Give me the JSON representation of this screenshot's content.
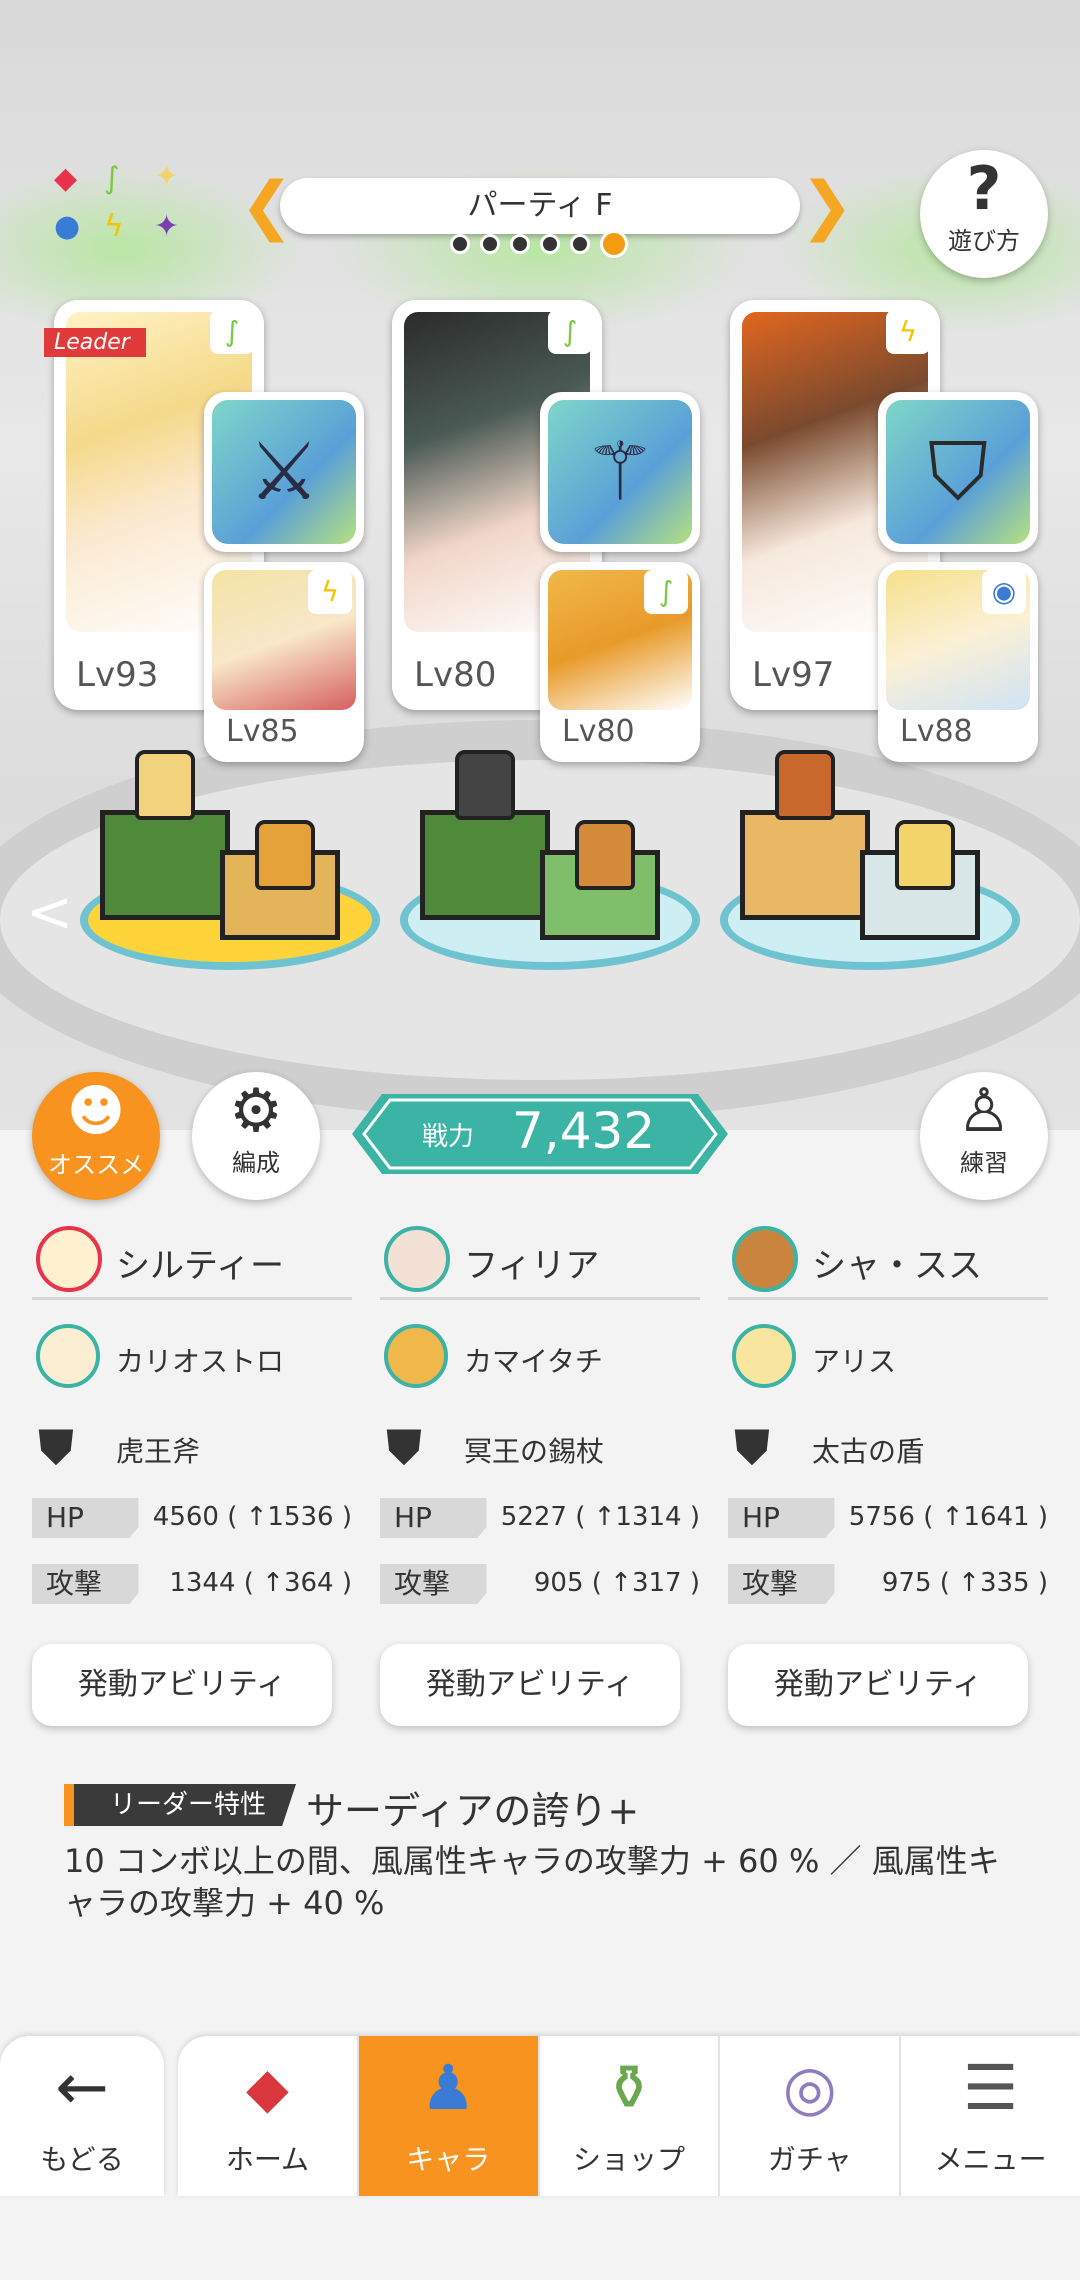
{
  "party": {
    "name": "パーティ F",
    "page_count": 6,
    "active_page": 6
  },
  "help_button": {
    "glyph": "?",
    "label": "遊び方"
  },
  "element_legend": [
    "◆",
    "∫",
    "✦",
    "●",
    "ϟ",
    "✦"
  ],
  "characters": [
    {
      "leader_tag": "Leader",
      "level": "Lv93",
      "element": "wind",
      "sub_level": "Lv85",
      "sub_element": "thunder",
      "name": "シルティー",
      "sub_name": "カリオストロ",
      "weapon": "虎王斧",
      "hp_label": "HP",
      "hp": "4560 ( ↑1536 )",
      "atk_label": "攻撃",
      "atk": "1344 ( ↑364 )",
      "ability_button": "発動アビリティ"
    },
    {
      "leader_tag": "",
      "level": "Lv80",
      "element": "wind",
      "sub_level": "Lv80",
      "sub_element": "wind",
      "name": "フィリア",
      "sub_name": "カマイタチ",
      "weapon": "冥王の錫杖",
      "hp_label": "HP",
      "hp": "5227 ( ↑1314 )",
      "atk_label": "攻撃",
      "atk": "905 ( ↑317 )",
      "ability_button": "発動アビリティ"
    },
    {
      "leader_tag": "",
      "level": "Lv97",
      "element": "thunder",
      "sub_level": "Lv88",
      "sub_element": "water",
      "name": "シャ・スス",
      "sub_name": "アリス",
      "weapon": "太古の盾",
      "hp_label": "HP",
      "hp": "5756 ( ↑1641 )",
      "atk_label": "攻撃",
      "atk": "975 ( ↑335 )",
      "ability_button": "発動アビリティ"
    }
  ],
  "actions": {
    "recommend_label": "オススメ",
    "formation_label": "編成",
    "practice_label": "練習",
    "power_label": "戦力",
    "power_value": "7,432"
  },
  "leader_skill": {
    "tag": "リーダー特性",
    "name": "サーディアの誇り+",
    "description": "10 コンボ以上の間、風属性キャラの攻撃力 + 60 % ／ 風属性キャラの攻撃力 + 40 %"
  },
  "nav": {
    "back_label": "もどる",
    "tabs": [
      {
        "label": "ホーム",
        "icon": "home-icon"
      },
      {
        "label": "キャラ",
        "icon": "character-icon",
        "active": true
      },
      {
        "label": "ショップ",
        "icon": "shop-icon"
      },
      {
        "label": "ガチャ",
        "icon": "gacha-icon"
      },
      {
        "label": "メニュー",
        "icon": "menu-icon"
      }
    ]
  },
  "colors": {
    "accent_orange": "#f7931e",
    "teal": "#3bb3a5",
    "wind": "#7ac943",
    "thunder": "#f5c400",
    "water": "#3a7bd5"
  }
}
